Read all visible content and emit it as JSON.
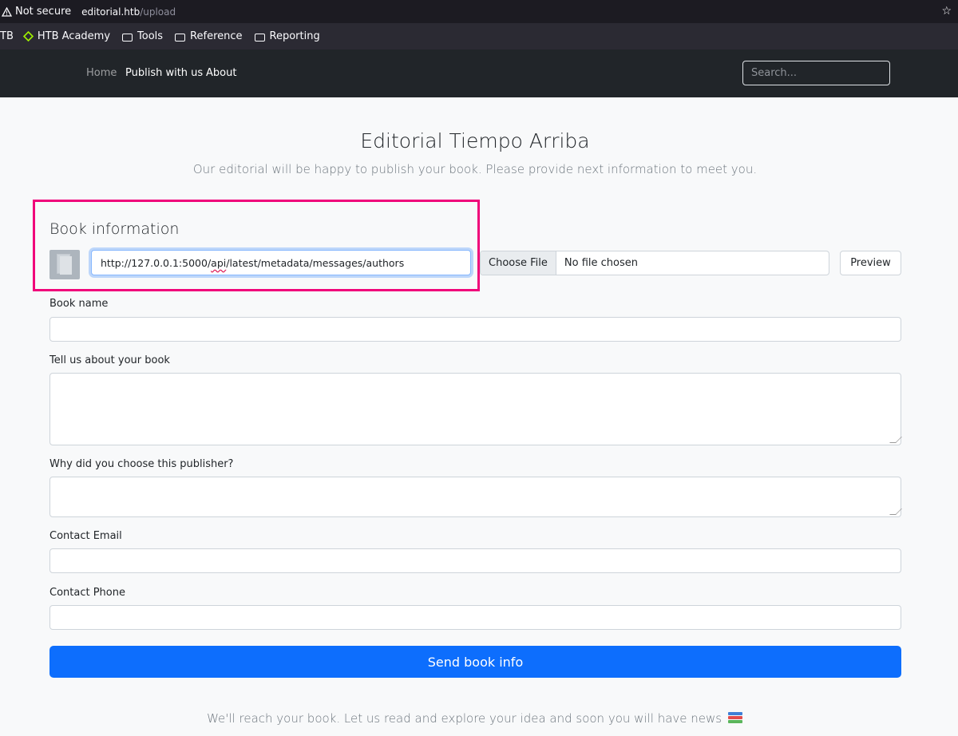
{
  "browser": {
    "security_label": "Not secure",
    "url_host": "editorial.htb",
    "url_path": "/upload",
    "bookmarks": [
      {
        "label": "TB",
        "icon": "none"
      },
      {
        "label": "HTB Academy",
        "icon": "cube-icon"
      },
      {
        "label": "Tools",
        "icon": "folder-icon"
      },
      {
        "label": "Reference",
        "icon": "folder-icon"
      },
      {
        "label": "Reporting",
        "icon": "folder-icon"
      }
    ]
  },
  "navbar": {
    "links": [
      {
        "label": "Home",
        "active": false
      },
      {
        "label": "Publish with us",
        "active": true
      },
      {
        "label": "About",
        "active": true
      }
    ],
    "search_placeholder": "Search..."
  },
  "header": {
    "title": "Editorial Tiempo Arriba",
    "subtitle": "Our editorial will be happy to publish your book. Please provide next information to meet you."
  },
  "form": {
    "section_title": "Book information",
    "cover_url_value_prefix": "http://127.0.0.1:5000/",
    "cover_url_value_squiggle": "api",
    "cover_url_value_suffix": "/latest/metadata/messages/authors",
    "file_button_label": "Choose File",
    "file_status": "No file chosen",
    "preview_label": "Preview",
    "book_name_label": "Book name",
    "about_label": "Tell us about your book",
    "why_label": "Why did you choose this publisher?",
    "email_label": "Contact Email",
    "phone_label": "Contact Phone",
    "submit_label": "Send book info"
  },
  "footer": {
    "text": "We'll reach your book. Let us read and explore your idea and soon you will have news"
  },
  "colors": {
    "highlight": "#f0057a",
    "primary": "#0d6efd",
    "navbar": "#212529"
  }
}
